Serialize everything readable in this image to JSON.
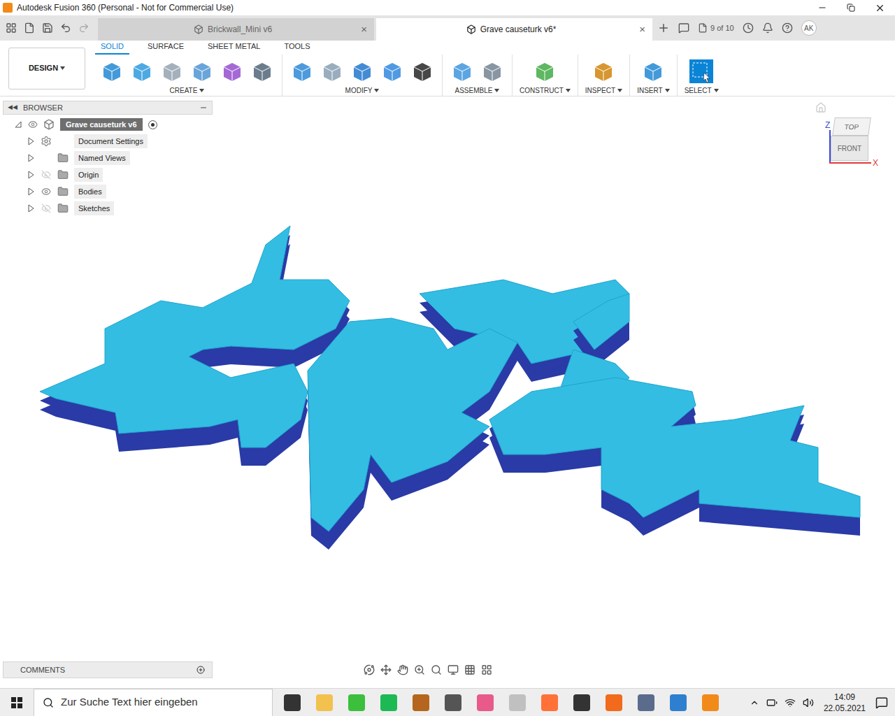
{
  "window": {
    "title": "Autodesk Fusion 360 (Personal - Not for Commercial Use)"
  },
  "document_tabs": [
    {
      "label": "Brickwall_Mini v6",
      "selected": false,
      "close": "×"
    },
    {
      "label": "Grave causeturk v6*",
      "selected": true,
      "close": "×"
    }
  ],
  "job_status": "9 of 10",
  "user": "AK",
  "workspace": "DESIGN",
  "toolbar_tabs": [
    {
      "label": "SOLID",
      "selected": true
    },
    {
      "label": "SURFACE",
      "selected": false
    },
    {
      "label": "SHEET METAL",
      "selected": false
    },
    {
      "label": "TOOLS",
      "selected": false
    }
  ],
  "tool_groups": [
    {
      "label": "CREATE",
      "active": false
    },
    {
      "label": "MODIFY",
      "active": false
    },
    {
      "label": "ASSEMBLE",
      "active": false
    },
    {
      "label": "CONSTRUCT",
      "active": false
    },
    {
      "label": "INSPECT",
      "active": false
    },
    {
      "label": "INSERT",
      "active": false
    },
    {
      "label": "SELECT",
      "active": true
    }
  ],
  "browser": {
    "title": "BROWSER",
    "root": {
      "label": "Grave causeturk v6",
      "expanded": true
    },
    "items": [
      {
        "label": "Document Settings",
        "kind": "settings",
        "visibility": "none",
        "expanded": false
      },
      {
        "label": "Named Views",
        "kind": "folder",
        "visibility": "none",
        "expanded": false
      },
      {
        "label": "Origin",
        "kind": "folder",
        "visibility": "hidden",
        "expanded": false
      },
      {
        "label": "Bodies",
        "kind": "folder",
        "visibility": "shown",
        "expanded": false
      },
      {
        "label": "Sketches",
        "kind": "folder",
        "visibility": "hidden",
        "expanded": false
      }
    ]
  },
  "view_cube": {
    "top": "TOP",
    "front": "FRONT",
    "axes": [
      "Z",
      "X"
    ]
  },
  "comments": {
    "title": "COMMENTS"
  },
  "taskbar": {
    "search_placeholder": "Zur Suche Text hier eingeben",
    "time": "14:09",
    "date": "22.05.2021"
  }
}
